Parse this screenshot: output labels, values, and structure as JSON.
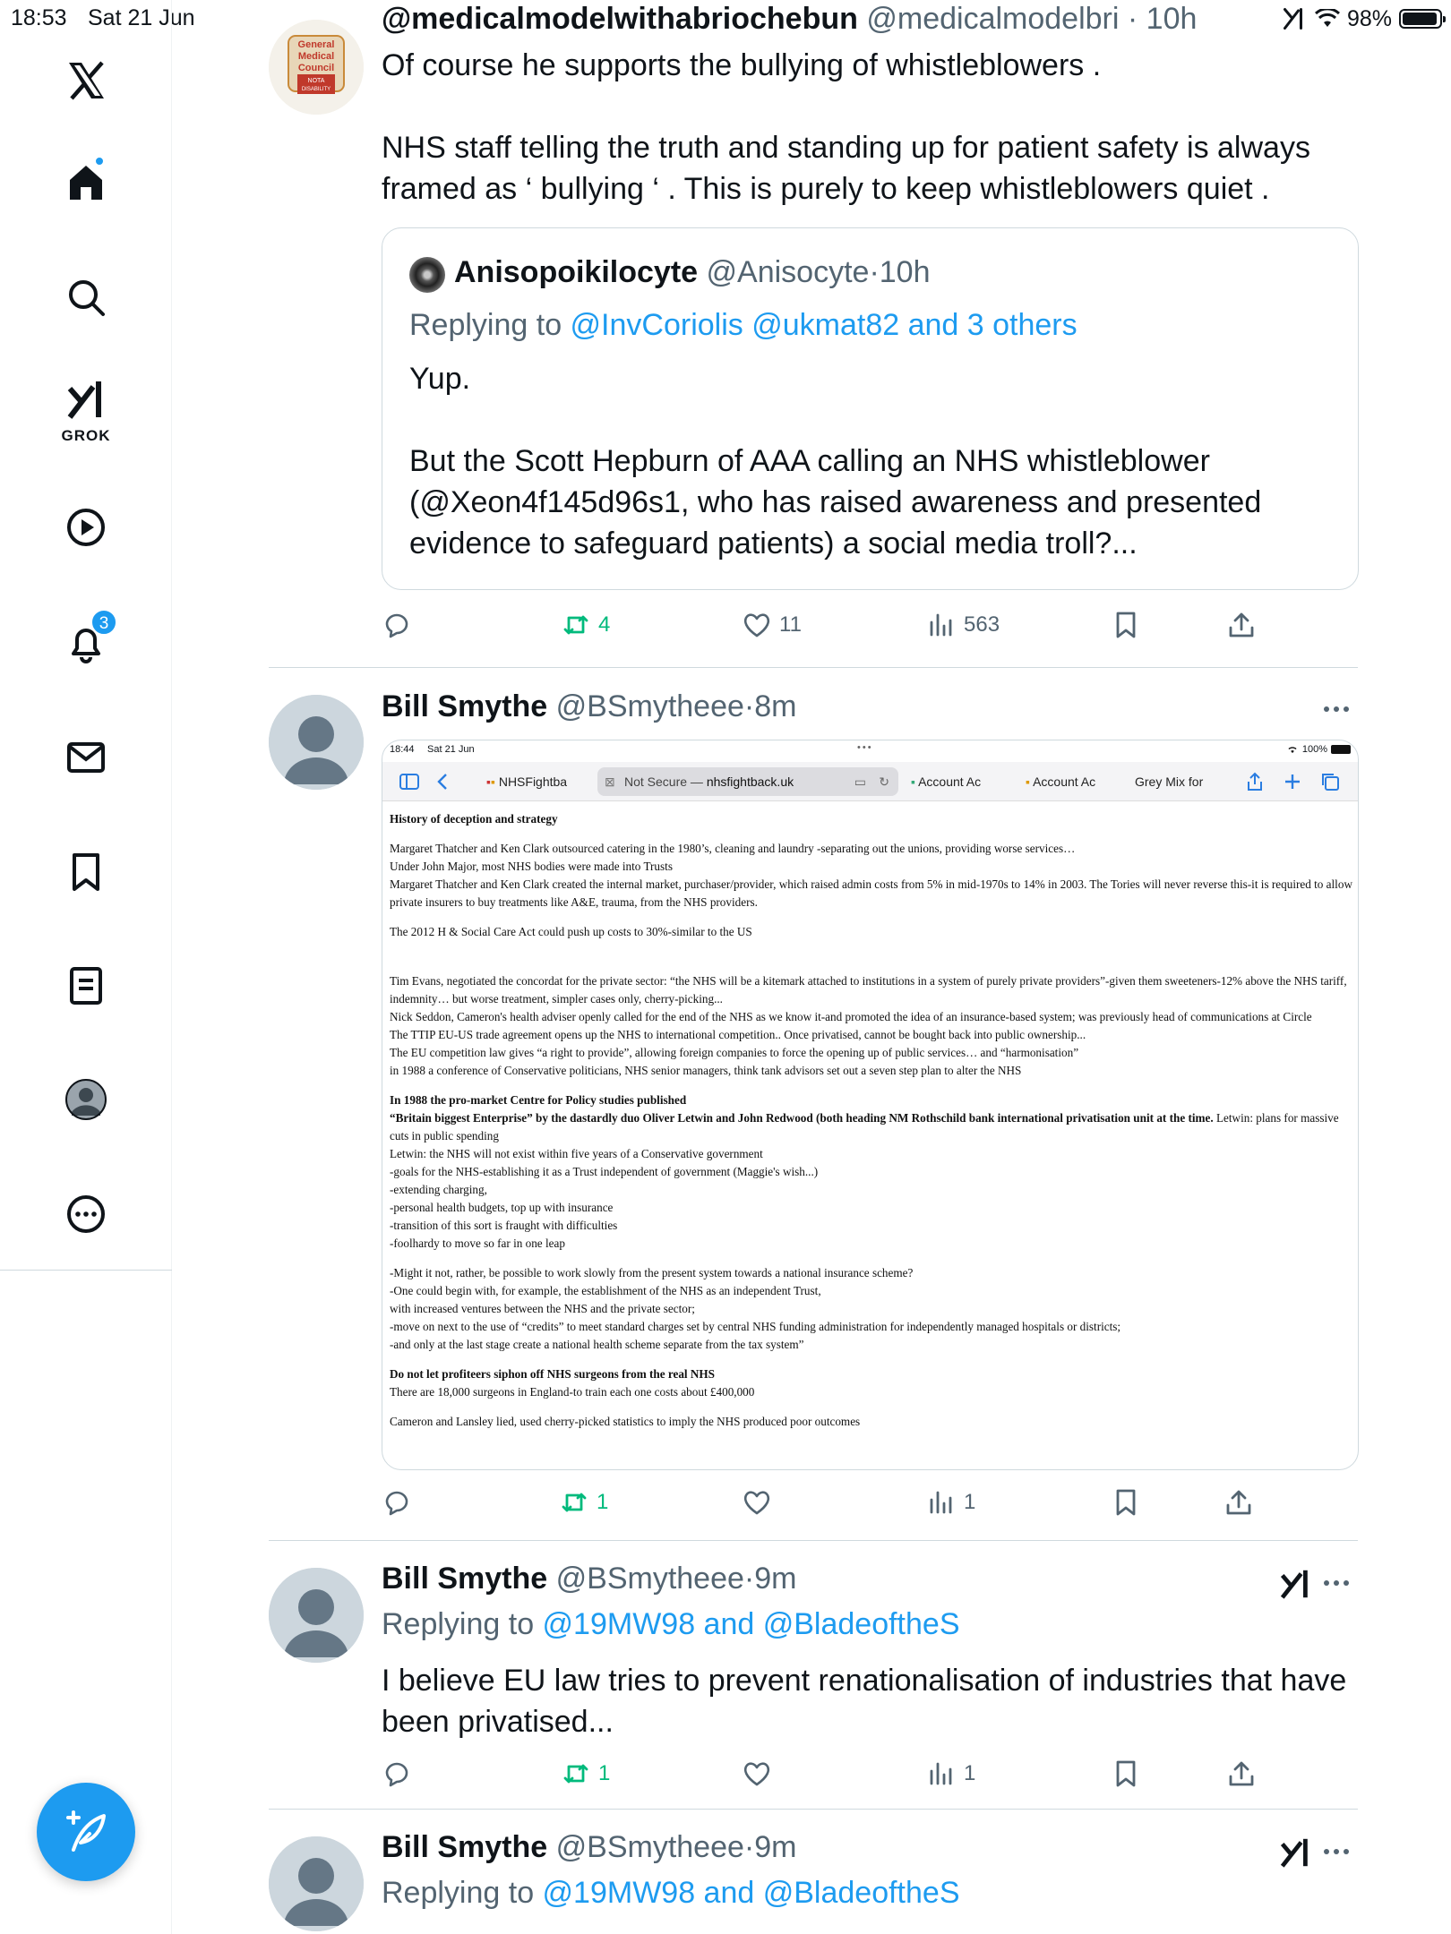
{
  "status_bar": {
    "time": "18:53",
    "date": "Sat 21 Jun",
    "battery": "98%"
  },
  "sidebar": {
    "grok_label": "GROK",
    "notifications_count": "3"
  },
  "colors": {
    "accent": "#1d9bf0",
    "retweet_green": "#00ba7c",
    "secondary_text": "#536471"
  },
  "tweets": [
    {
      "name": "@medicalmodelwithabriochebun",
      "handle": "@medicalmodelbri",
      "dot": "·",
      "time": "10h",
      "text_1": "Of course he supports the bullying of whistleblowers .",
      "text_2": "NHS staff telling the truth and standing up for patient safety is always framed as ‘ bullying ‘ . This is purely to keep whistleblowers quiet .",
      "avatar_text": [
        "General",
        "Medical",
        "Council",
        "NOTA",
        "DISABILITY"
      ],
      "quote": {
        "name": "Anisopoikilocyte",
        "handle": "@Anisocyte",
        "dot": "·",
        "time": "10h",
        "replying_prefix": "Replying to ",
        "replying_links": "@InvCoriolis @ukmat82 and 3 others",
        "text_1": "Yup.",
        "text_2": "But the Scott Hepburn of AAA calling an NHS whistleblower (@Xeon4f145d96s1, who has raised awareness and presented evidence to safeguard patients) a social media troll?..."
      },
      "stats": {
        "retweets": "4",
        "likes": "11",
        "views": "563"
      }
    },
    {
      "name": "Bill Smythe",
      "handle": "@BSmytheee",
      "dot": "·",
      "time": "8m",
      "stats": {
        "retweets": "1",
        "likes": "",
        "views": "1"
      },
      "media": {
        "status_time": "18:44",
        "status_date": "Sat 21 Jun",
        "status_dots": "•••",
        "status_battery": "100%",
        "tab_1": "NHSFightba",
        "url_prefix": "Not Secure — ",
        "url_domain": "nhsfightback.uk",
        "tab_2": "Account Ac",
        "tab_3": "Account Ac",
        "tab_4": "Grey Mix for",
        "doc": {
          "heading": "History of deception and strategy",
          "p1": "Margaret Thatcher and Ken Clark outsourced catering in the 1980’s, cleaning and laundry -separating out the unions, providing worse services…",
          "p2": "Under John Major, most NHS bodies were made into Trusts",
          "p3": "Margaret Thatcher and Ken Clark created the internal market, purchaser/provider, which raised admin costs from 5% in mid-1970s to 14% in 2003. The Tories will never reverse this-it is required to allow private insurers to buy treatments like A&E, trauma, from the NHS providers.",
          "p4": "The 2012 H & Social Care Act could push up costs to 30%-similar to the US",
          "p5": "Tim Evans, negotiated the concordat for the private sector: “the NHS will be a kitemark attached to institutions in a system of purely private providers”-given them sweeteners-12% above the NHS tariff, indemnity… but worse treatment, simpler cases only, cherry-picking...",
          "p6": "Nick Seddon, Cameron's health adviser openly called for the end of the NHS as we know it-and promoted the idea of an insurance-based system; was previously head of communications at Circle",
          "p7": "The TTIP EU-US trade agreement opens up the NHS to international competition.. Once privatised, cannot be bought back into public ownership...",
          "p8": "The EU competition law gives “a right to provide”, allowing foreign companies to force the opening up of public services… and “harmonisation”",
          "p9": "in 1988 a conference of Conservative politicians, NHS senior managers, think tank advisors set out a seven step plan to alter the NHS",
          "b1": "In 1988 the pro-market Centre for Policy studies published",
          "b2": "“Britain biggest Enterprise” by the dastardly duo Oliver Letwin and John Redwood (both heading NM Rothschild bank international privatisation unit at the time.",
          "b2_tail": " Letwin: plans for massive cuts in public spending",
          "l1": "Letwin: the NHS will not exist within five years of a Conservative government",
          "l2": "-goals for the NHS-establishing it as a Trust independent of government (Maggie's wish...)",
          "l3": "-extending charging,",
          "l4": "-personal health budgets, top up with insurance",
          "l5": "-transition of this sort is fraught with difficulties",
          "l6": "-foolhardy to move so far in one leap",
          "m1": "-Might it not, rather, be possible to work slowly from the present system towards a national insurance scheme?",
          "m2": "-One could begin with, for example, the establishment of the NHS as an independent Trust,",
          "m3": "with increased ventures between the NHS and the private sector;",
          "m4": "-move on next to the use of “credits” to meet standard charges set by central NHS funding administration for independently managed hospitals or districts;",
          "m5": "-and only at the last stage create a national health scheme separate from the tax system”",
          "s_head": "Do not let profiteers siphon off NHS surgeons from the real NHS",
          "s1": "There are 18,000 surgeons in England-to train each one costs about £400,000",
          "s2": "Cameron and Lansley lied, used cherry-picked statistics to imply the NHS produced poor outcomes"
        }
      }
    },
    {
      "name": "Bill Smythe",
      "handle": "@BSmytheee",
      "dot": "·",
      "time": "9m",
      "replying_prefix": "Replying to ",
      "replying_links": "@19MW98 and @BladeoftheS",
      "text_1": "I believe EU law tries to prevent renationalisation of industries that have been privatised...",
      "stats": {
        "retweets": "1",
        "likes": "",
        "views": "1"
      }
    },
    {
      "name": "Bill Smythe",
      "handle": "@BSmytheee",
      "dot": "·",
      "time": "9m",
      "replying_prefix": "Replying to ",
      "replying_links": "@19MW98 and @BladeoftheS"
    }
  ]
}
